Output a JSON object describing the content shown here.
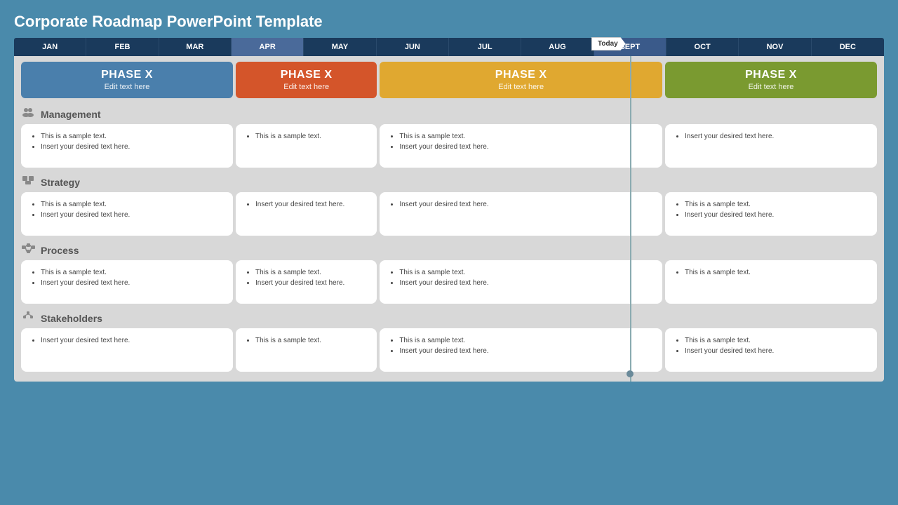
{
  "title": "Corporate Roadmap PowerPoint Template",
  "today_label": "Today",
  "months": [
    "JAN",
    "FEB",
    "MAR",
    "APR",
    "MAY",
    "JUN",
    "JUL",
    "AUG",
    "SEPT",
    "OCT",
    "NOV",
    "DEC"
  ],
  "today_month_index": 8,
  "phases": [
    {
      "label": "PHASE X",
      "sub": "Edit text here",
      "color": "blue",
      "span": "3fr"
    },
    {
      "label": "PHASE X",
      "sub": "Edit text here",
      "color": "orange",
      "span": "2fr"
    },
    {
      "label": "PHASE X",
      "sub": "Edit text here",
      "color": "yellow",
      "span": "4fr"
    },
    {
      "label": "PHASE X",
      "sub": "Edit text here",
      "color": "green",
      "span": "3fr"
    }
  ],
  "sections": [
    {
      "name": "Management",
      "icon": "👥",
      "cards": [
        {
          "items": [
            "This is a sample text.",
            "Insert your desired text here."
          ]
        },
        {
          "items": [
            "This is a sample text."
          ]
        },
        {
          "items": [
            "This is a sample text.",
            "Insert your desired text here."
          ]
        },
        {
          "items": [
            "Insert your desired text here."
          ]
        }
      ]
    },
    {
      "name": "Strategy",
      "icon": "🔧",
      "cards": [
        {
          "items": [
            "This is a sample text.",
            "Insert your desired text here."
          ]
        },
        {
          "items": [
            "Insert your desired text here."
          ]
        },
        {
          "items": [
            "Insert your desired text here."
          ]
        },
        {
          "items": [
            "This is a sample text.",
            "Insert your desired text here."
          ]
        }
      ]
    },
    {
      "name": "Process",
      "icon": "🔄",
      "cards": [
        {
          "items": [
            "This is a sample text.",
            "Insert your desired text here."
          ]
        },
        {
          "items": [
            "This is a sample text.",
            "Insert your desired text here."
          ]
        },
        {
          "items": [
            "This is a sample text.",
            "Insert your desired text here."
          ]
        },
        {
          "items": [
            "This is a sample text."
          ]
        }
      ]
    },
    {
      "name": "Stakeholders",
      "icon": "🏢",
      "cards": [
        {
          "items": [
            "Insert your desired text here."
          ]
        },
        {
          "items": [
            "This is a sample text."
          ]
        },
        {
          "items": [
            "This is a sample text.",
            "Insert your desired text here."
          ]
        },
        {
          "items": [
            "This is a sample text.",
            "Insert your desired text here."
          ]
        }
      ]
    }
  ]
}
